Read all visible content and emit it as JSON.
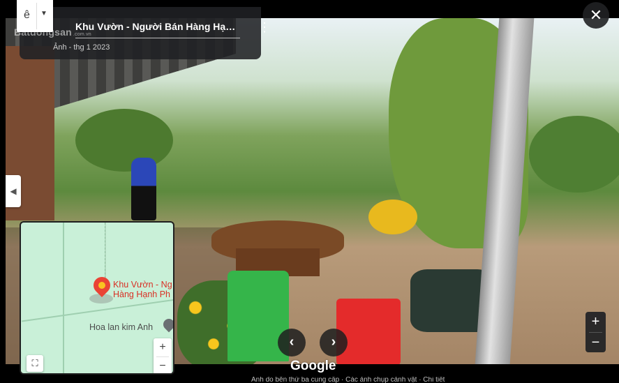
{
  "language_button": {
    "glyph": "ê",
    "caret": "▼",
    "icon": "language-icon"
  },
  "title_card": {
    "title": "Khu Vườn - Người Bán Hàng Hạn...",
    "date": "Ảnh - thg 1 2023",
    "more_icon": "⋮"
  },
  "watermark": {
    "text": "Batdongsan",
    "suffix": ".com.vn"
  },
  "close_button": {
    "glyph": "✕"
  },
  "collapse_button": {
    "glyph": "◀"
  },
  "minimap": {
    "pin_label_line1": "Khu Vườn - Ng",
    "pin_label_line2": "Hàng Hạnh Ph",
    "place_label": "Hoa lan kim Anh",
    "zoom_in": "+",
    "zoom_out": "−",
    "expand_glyph": "⛶"
  },
  "nav": {
    "prev": "‹",
    "next": "›"
  },
  "google_logo": "Google",
  "main_zoom": {
    "zoom_in": "+",
    "zoom_out": "−"
  },
  "bottom_text": "Ảnh do bên thứ ba cung cấp · Các ảnh chụp cảnh vật · Chi tiết"
}
